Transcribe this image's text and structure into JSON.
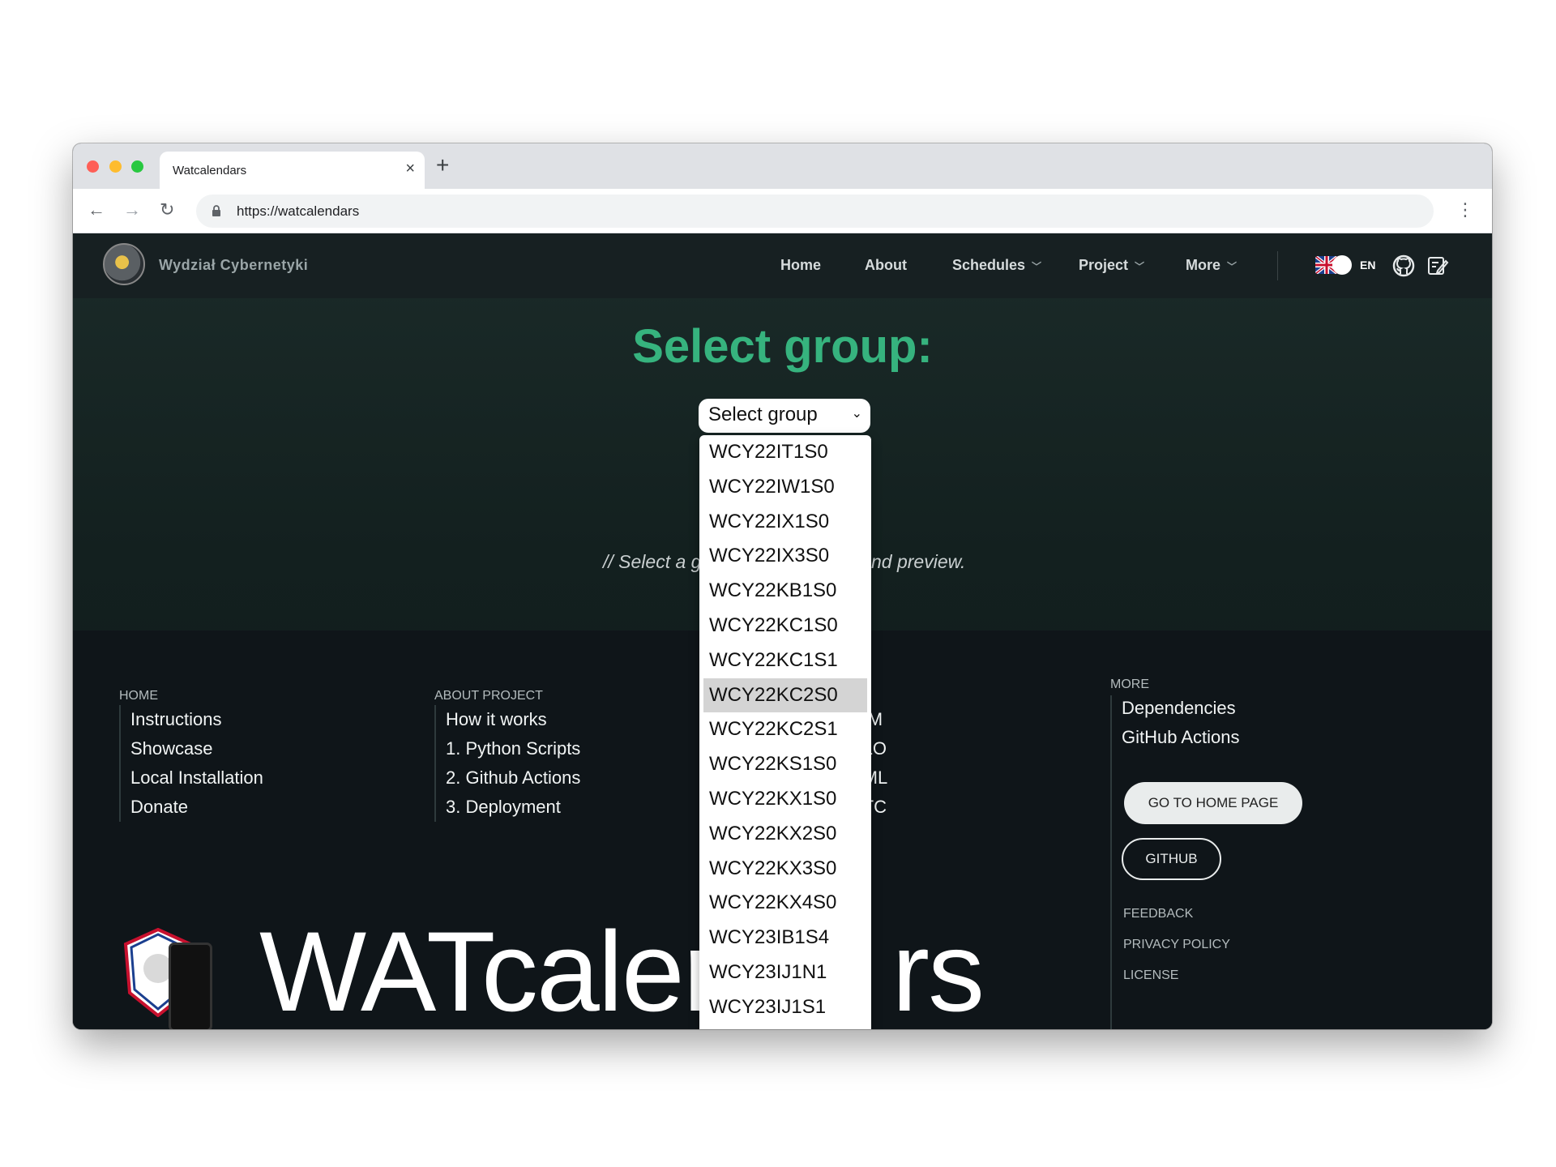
{
  "browser": {
    "tab_title": "Watcalendars",
    "url": "https://watcalendars"
  },
  "navbar": {
    "brand": "Wydział Cybernetyki",
    "items": [
      {
        "label": "Home",
        "has_menu": false
      },
      {
        "label": "About",
        "has_menu": false
      },
      {
        "label": "Schedules",
        "has_menu": true
      },
      {
        "label": "Project",
        "has_menu": true
      },
      {
        "label": "More",
        "has_menu": true
      }
    ],
    "language": "EN"
  },
  "hero": {
    "title": "Select group:",
    "select_value": "Select group",
    "hint_left": "// Select a g",
    "hint_right": "nd preview."
  },
  "dropdown": {
    "highlighted": "WCY22KC2S0",
    "options": [
      "WCY22IT1S0",
      "WCY22IW1S0",
      "WCY22IX1S0",
      "WCY22IX3S0",
      "WCY22KB1S0",
      "WCY22KC1S0",
      "WCY22KC1S1",
      "WCY22KC2S0",
      "WCY22KC2S1",
      "WCY22KS1S0",
      "WCY22KX1S0",
      "WCY22KX2S0",
      "WCY22KX3S0",
      "WCY22KX4S0",
      "WCY23IB1S4",
      "WCY23IJ1N1",
      "WCY23IJ1S1"
    ]
  },
  "footer": {
    "home": {
      "heading": "HOME",
      "links": [
        "Instructions",
        "Showcase",
        "Local Installation",
        "Donate"
      ]
    },
    "about": {
      "heading": "ABOUT PROJECT",
      "links": [
        "How it works",
        "1. Python Scripts",
        "2. Github Actions",
        "3. Deployment"
      ]
    },
    "schedules_partial": [
      "VIM",
      "VLO",
      "VML",
      "VTC"
    ],
    "more": {
      "heading": "MORE",
      "links": [
        "Dependencies",
        "GitHub Actions"
      ]
    },
    "buttons": {
      "home": "GO TO HOME PAGE",
      "github": "GITHUB"
    },
    "small_links": [
      "FEEDBACK",
      "PRIVACY POLICY",
      "LICENSE"
    ],
    "big_brand_left": "WATcaler",
    "big_brand_right": "rs"
  },
  "colors": {
    "accent": "#36b37e",
    "navbar": "#172022",
    "footer": "#0f1519"
  }
}
